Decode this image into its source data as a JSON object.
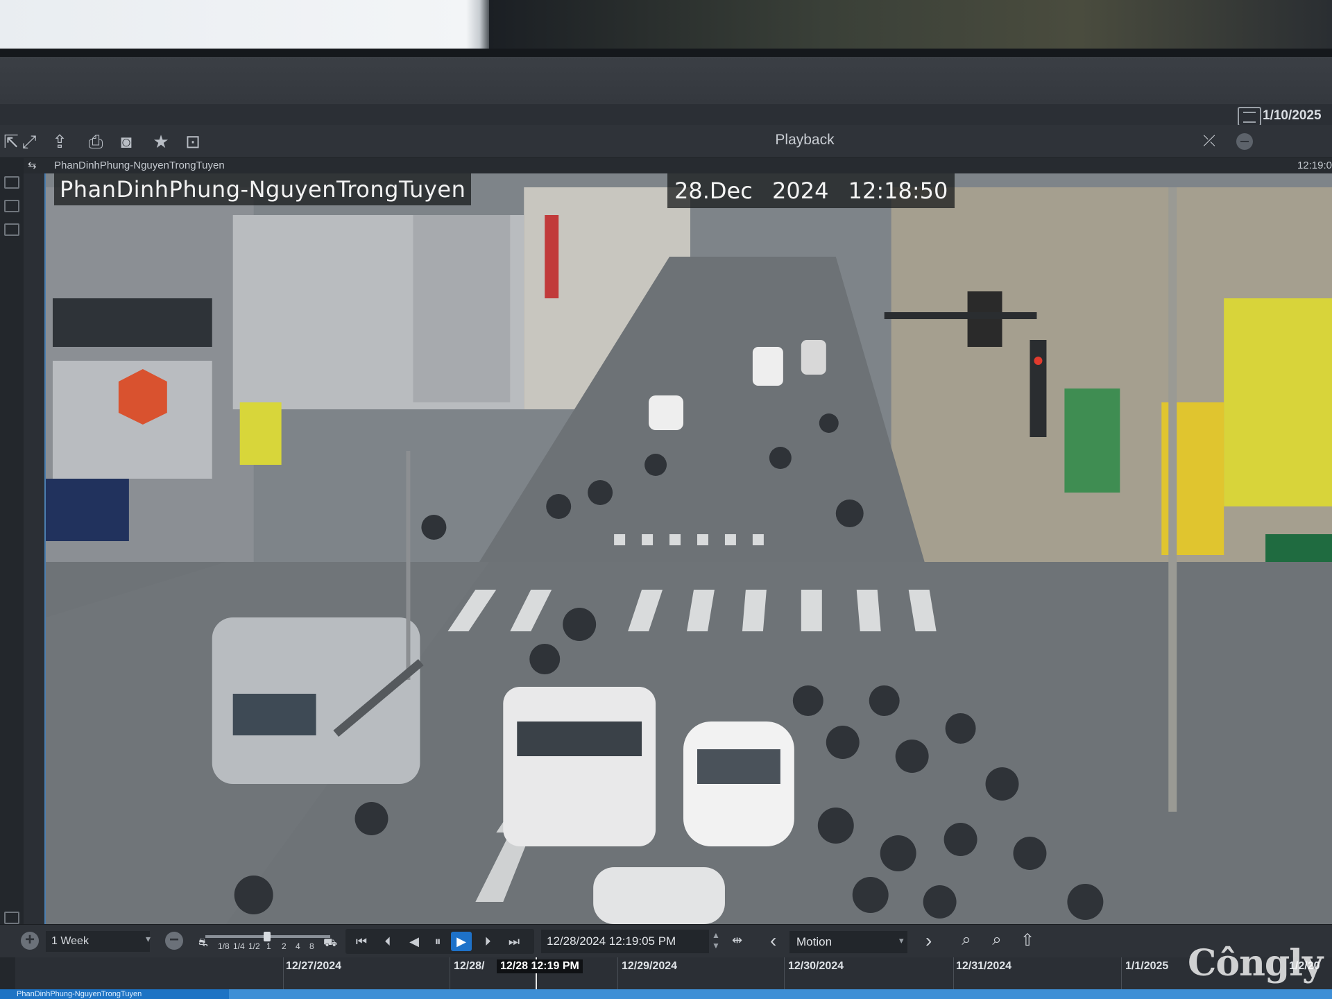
{
  "window": {
    "title": "Playback",
    "system_date": "1/10/2025"
  },
  "tile": {
    "header_name": "PhanDinhPhung-NguyenTrongTuyen",
    "header_time": "12:19:0",
    "overlay_camera_name": "PhanDinhPhung-NguyenTrongTuyen",
    "overlay_date": "28.Dec 2024",
    "overlay_time": "12:18:50"
  },
  "controls": {
    "range_value": "1 Week",
    "speed_labels": [
      "1/8",
      "1/4",
      "1/2",
      "1",
      "2",
      "4",
      "8"
    ],
    "speed_level": "1",
    "datetime_value": "12/28/2024 12:19:05 PM",
    "search_type": "Motion"
  },
  "timeline": {
    "day_labels": [
      "12/27/2024",
      "12/28/",
      "12/29/2024",
      "12/30/2024",
      "12/31/2024",
      "1/1/2025",
      "1/2/20"
    ],
    "cursor_label": "12/28 12:19 PM",
    "track_name": "PhanDinhPhung-NguyenTrongTuyen"
  },
  "icons": {
    "toolbar": [
      "pin-icon",
      "expand-icon",
      "export-icon",
      "print-icon",
      "camera-icon",
      "star-icon",
      "fit-icon"
    ],
    "playback": [
      "skip-start-icon",
      "step-back-icon",
      "reverse-play-icon",
      "pause-icon",
      "play-icon",
      "step-forward-icon",
      "skip-end-icon"
    ],
    "tools": [
      "zoom-in-icon",
      "zoom-out-icon",
      "export-clip-icon"
    ]
  },
  "watermark": "Côngly"
}
